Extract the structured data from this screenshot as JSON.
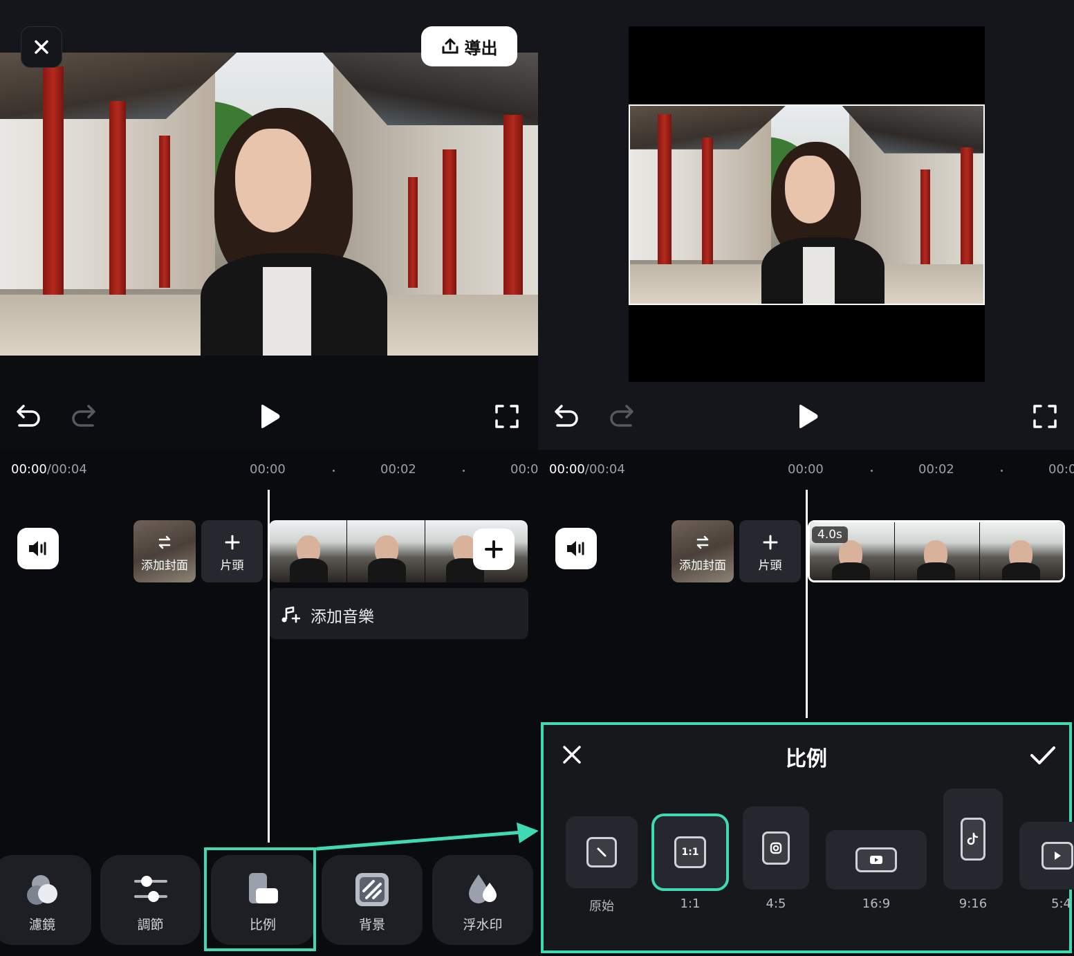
{
  "left": {
    "export_label": "導出",
    "time_current": "00:00",
    "time_total": "/00:04",
    "ruler": [
      "00:00",
      "00:02",
      "00:0"
    ],
    "cover_label": "添加封面",
    "intro_label": "片頭",
    "music_label": "添加音樂",
    "tools": [
      {
        "label": "濾鏡",
        "icon": "filter-icon"
      },
      {
        "label": "調節",
        "icon": "adjust-icon"
      },
      {
        "label": "比例",
        "icon": "ratio-icon"
      },
      {
        "label": "背景",
        "icon": "background-icon"
      },
      {
        "label": "浮水印",
        "icon": "watermark-icon"
      }
    ]
  },
  "right": {
    "time_current": "00:00",
    "time_total": "/00:04",
    "ruler": [
      "00:00",
      "00:02",
      "00:0"
    ],
    "cover_label": "添加封面",
    "intro_label": "片頭",
    "clip_duration": "4.0s",
    "panel": {
      "title": "比例",
      "ratios": [
        {
          "label": "原始",
          "icon": "original-icon"
        },
        {
          "label": "1:1",
          "icon": "1-1-icon",
          "selected": true
        },
        {
          "label": "4:5",
          "icon": "instagram-icon"
        },
        {
          "label": "16:9",
          "icon": "youtube-icon"
        },
        {
          "label": "9:16",
          "icon": "tiktok-icon"
        },
        {
          "label": "5:4",
          "icon": "play-icon"
        }
      ],
      "ratio_inner_text": "1:1"
    }
  },
  "colors": {
    "accent": "#3fd9b3",
    "background": "#0c0d10",
    "panel": "#16181c"
  }
}
